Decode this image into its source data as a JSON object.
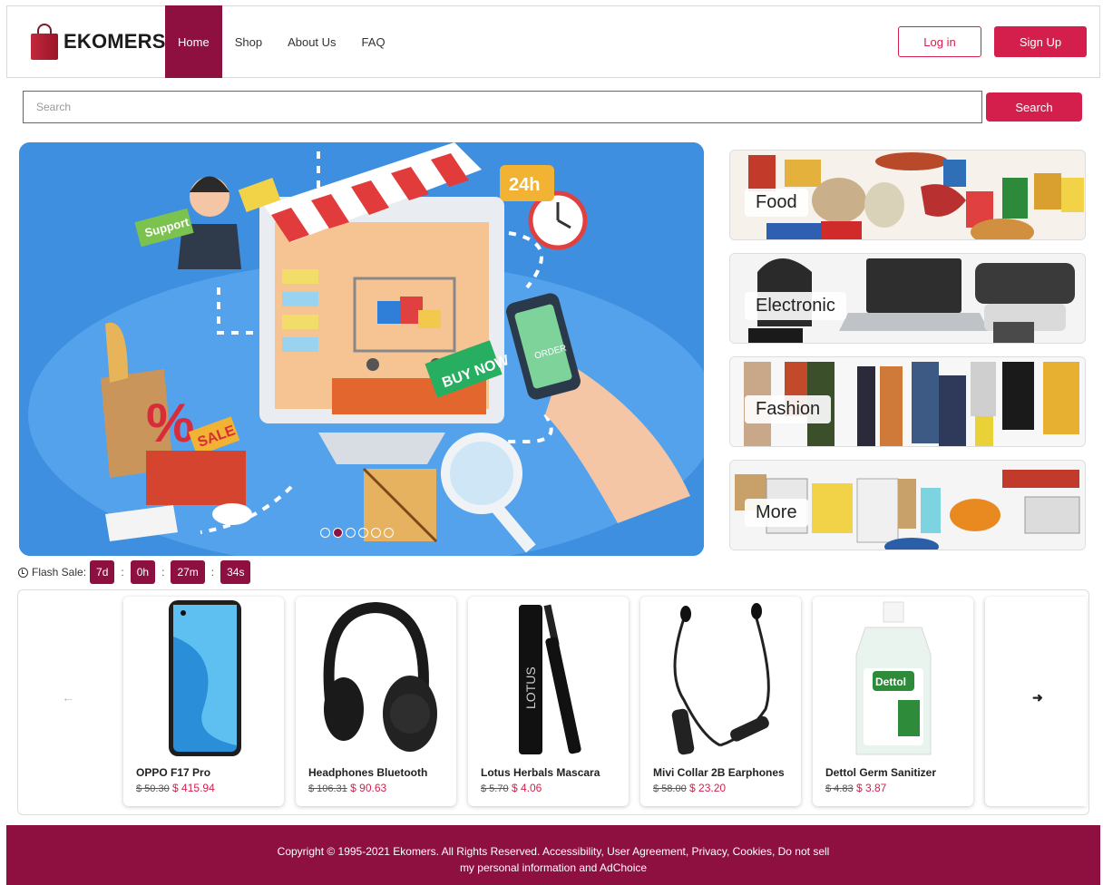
{
  "brand": {
    "name": "EKOMERS"
  },
  "nav": {
    "links": [
      {
        "label": "Home",
        "active": true
      },
      {
        "label": "Shop",
        "active": false
      },
      {
        "label": "About Us",
        "active": false
      },
      {
        "label": "FAQ",
        "active": false
      }
    ],
    "login_label": "Log in",
    "signup_label": "Sign Up"
  },
  "search": {
    "placeholder": "Search",
    "button_label": "Search"
  },
  "hero": {
    "slide_count": 6,
    "active_slide": 2,
    "artwork_text": {
      "support": "Support",
      "sale": "SALE",
      "buy_now": "BUY NOW",
      "hours": "24h",
      "order": "ORDER"
    }
  },
  "categories": [
    {
      "label": "Food"
    },
    {
      "label": "Electronic"
    },
    {
      "label": "Fashion"
    },
    {
      "label": "More"
    }
  ],
  "flash_sale": {
    "label": "Flash Sale:",
    "days": "7d",
    "hours": "0h",
    "minutes": "27m",
    "seconds": "34s"
  },
  "products": [
    {
      "name": "OPPO F17 Pro",
      "old_price": "$ 50.30",
      "price": "$ 415.94"
    },
    {
      "name": "Headphones Bluetooth",
      "old_price": "$ 106.31",
      "price": "$ 90.63"
    },
    {
      "name": "Lotus Herbals Mascara",
      "old_price": "$ 5.70",
      "price": "$ 4.06"
    },
    {
      "name": "Mivi Collar 2B Earphones",
      "old_price": "$ 58.00",
      "price": "$ 23.20"
    },
    {
      "name": "Dettol Germ Sanitizer",
      "old_price": "$ 4.83",
      "price": "$ 3.87"
    }
  ],
  "product_artwork_text": {
    "mascara_brand": "LOTUS",
    "sanitizer_brand": "Dettol"
  },
  "footer": {
    "copyright": "Copyright © 1995-2021 Ekomers. All Rights Reserved. Accessibility, User Agreement, Privacy, Cookies, Do not sell my personal information and AdChoice"
  },
  "colors": {
    "primary": "#8d1041",
    "accent": "#d41f4d",
    "hero_bg": "#3f8fe0"
  },
  "icons": {
    "prev": "arrow-left-icon",
    "next": "arrow-right-icon",
    "clock": "clock-icon"
  }
}
